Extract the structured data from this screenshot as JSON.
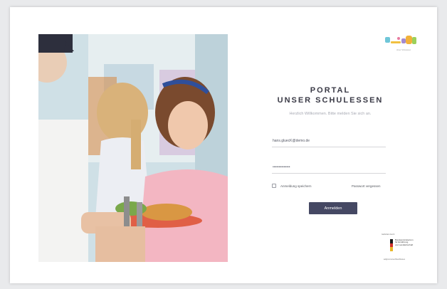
{
  "portal": {
    "title_line1": "PORTAL",
    "title_line2": "UNSER SCHULESSEN",
    "subtitle": "Herzlich Willkommen. Bitte melden Sie sich an."
  },
  "form": {
    "email_value": "hans.gluecK@demo.de",
    "password_value": "••••••••••••••",
    "remember_label": "Anmeldung speichern",
    "forgot_label": "Passwort vergessen",
    "submit_label": "Anmelden"
  },
  "logo": {
    "caption": "Unser Schulessen"
  },
  "sponsor": {
    "top_label": "Gefördert durch:",
    "text_line1": "Bundesministerium",
    "text_line2": "für Ernährung",
    "text_line3": "und Landwirtschaft",
    "bottom_label": "aufgrund eines Beschlusses"
  },
  "colors": {
    "button_bg": "#454863",
    "title_text": "#3a3a46",
    "flag_black": "#1a1a1a",
    "flag_red": "#d0302b",
    "flag_gold": "#e9b82a"
  },
  "icons": {
    "checkbox": "checkbox-icon",
    "logo": "brand-logo-icon",
    "eagle": "federal-eagle-icon"
  }
}
